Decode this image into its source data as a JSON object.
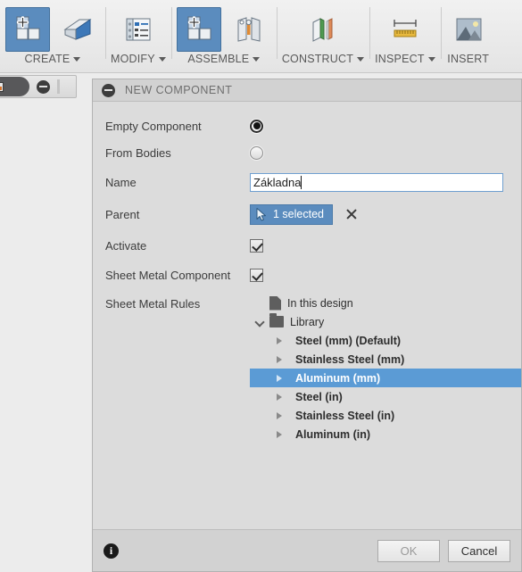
{
  "toolbar": {
    "groups": [
      {
        "label": "CREATE",
        "icons": [
          "new-component-icon",
          "flange-icon"
        ],
        "active_index": 0,
        "has_caret": true
      },
      {
        "label": "MODIFY",
        "icons": [
          "edit-list-icon"
        ],
        "active_index": -1,
        "has_caret": true
      },
      {
        "label": "ASSEMBLE",
        "icons": [
          "new-component-icon",
          "joint-icon"
        ],
        "active_index": 0,
        "has_caret": true
      },
      {
        "label": "CONSTRUCT",
        "icons": [
          "offset-plane-icon"
        ],
        "active_index": -1,
        "has_caret": true
      },
      {
        "label": "INSPECT",
        "icons": [
          "measure-icon"
        ],
        "active_index": -1,
        "has_caret": true
      },
      {
        "label": "INSERT",
        "icons": [
          "decal-icon"
        ],
        "active_index": -1,
        "has_caret": false
      }
    ]
  },
  "browser_panel": {
    "collapse_icon": "circle-minus-icon"
  },
  "dialog": {
    "title": "NEW COMPONENT",
    "collapse_icon": "circle-minus-icon",
    "rows": {
      "empty_component": {
        "label": "Empty Component",
        "selected": true
      },
      "from_bodies": {
        "label": "From Bodies",
        "selected": false
      },
      "name": {
        "label": "Name",
        "value": "Základna",
        "placeholder": ""
      },
      "parent": {
        "label": "Parent",
        "button_text": "1 selected",
        "clear_icon": "close-x-icon"
      },
      "activate": {
        "label": "Activate",
        "checked": true
      },
      "sheet_metal_component": {
        "label": "Sheet Metal Component",
        "checked": true
      },
      "sheet_metal_rules": {
        "label": "Sheet Metal Rules"
      }
    },
    "tree": [
      {
        "label": "In this design",
        "icon": "document-icon",
        "level": 1,
        "expander": "none",
        "bold": false,
        "selected": false
      },
      {
        "label": "Library",
        "icon": "folder-icon",
        "level": 1,
        "expander": "down",
        "bold": false,
        "selected": false
      },
      {
        "label": "Steel (mm) (Default)",
        "icon": "none",
        "level": 2,
        "expander": "right",
        "bold": true,
        "selected": false
      },
      {
        "label": "Stainless Steel (mm)",
        "icon": "none",
        "level": 2,
        "expander": "right",
        "bold": true,
        "selected": false
      },
      {
        "label": "Aluminum (mm)",
        "icon": "none",
        "level": 2,
        "expander": "right",
        "bold": true,
        "selected": true
      },
      {
        "label": "Steel (in)",
        "icon": "none",
        "level": 2,
        "expander": "right",
        "bold": true,
        "selected": false
      },
      {
        "label": "Stainless Steel (in)",
        "icon": "none",
        "level": 2,
        "expander": "right",
        "bold": true,
        "selected": false
      },
      {
        "label": "Aluminum (in)",
        "icon": "none",
        "level": 2,
        "expander": "right",
        "bold": true,
        "selected": false
      }
    ],
    "footer": {
      "info_icon": "info-icon",
      "info_glyph": "i",
      "ok_label": "OK",
      "ok_disabled": true,
      "cancel_label": "Cancel"
    }
  },
  "colors": {
    "accent_blue": "#5b9bd5",
    "button_blue": "#5b8cbe",
    "dialog_bg": "#dcdcdc",
    "footer_bg": "#d2d2d2",
    "viewport_bg": "#ececec"
  }
}
